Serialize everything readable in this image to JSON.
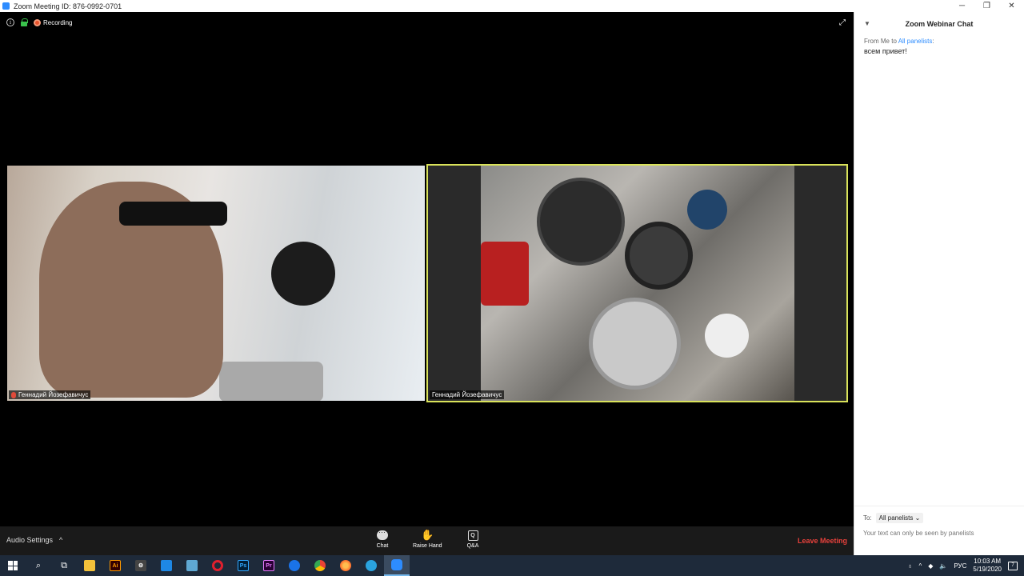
{
  "window": {
    "title": "Zoom Meeting ID: 876-0992-0701",
    "controls": [
      "minimize-icon",
      "restore-icon",
      "close-icon"
    ]
  },
  "meeting": {
    "recording_label": "Recording",
    "participants": [
      {
        "name": "Геннадий Йозефавичус",
        "muted": true
      },
      {
        "name": "Геннадий Йозефавичус",
        "muted": false,
        "active_speaker": true
      }
    ]
  },
  "toolbar": {
    "audio_settings_label": "Audio Settings",
    "buttons": [
      {
        "label": "Chat",
        "icon": "chat-icon"
      },
      {
        "label": "Raise Hand",
        "icon": "raise-hand-icon"
      },
      {
        "label": "Q&A",
        "icon": "qa-icon"
      }
    ],
    "leave_label": "Leave Meeting"
  },
  "chat": {
    "title": "Zoom Webinar Chat",
    "messages": [
      {
        "from_prefix": "From Me to ",
        "to": "All panelists",
        "to_suffix": ":",
        "text": "всем привет!"
      }
    ],
    "to_label": "To:",
    "to_value": "All panelists",
    "input_placeholder": "Your text can only be seen by panelists"
  },
  "taskbar": {
    "apps": [
      "start",
      "search",
      "task-view",
      "file-explorer",
      "illustrator",
      "app-gear",
      "app-blue",
      "app-feather",
      "opera",
      "photoshop",
      "premiere",
      "app-firefox-dev",
      "chrome",
      "firefox",
      "telegram",
      "zoom"
    ],
    "language": "РУС",
    "time": "10:03 AM",
    "date": "5/19/2020",
    "notification_count": "7"
  },
  "colors": {
    "zoom_blue": "#2D8CFF",
    "active_speaker_border": "#d9e25a",
    "leave_red": "#e8413b"
  }
}
